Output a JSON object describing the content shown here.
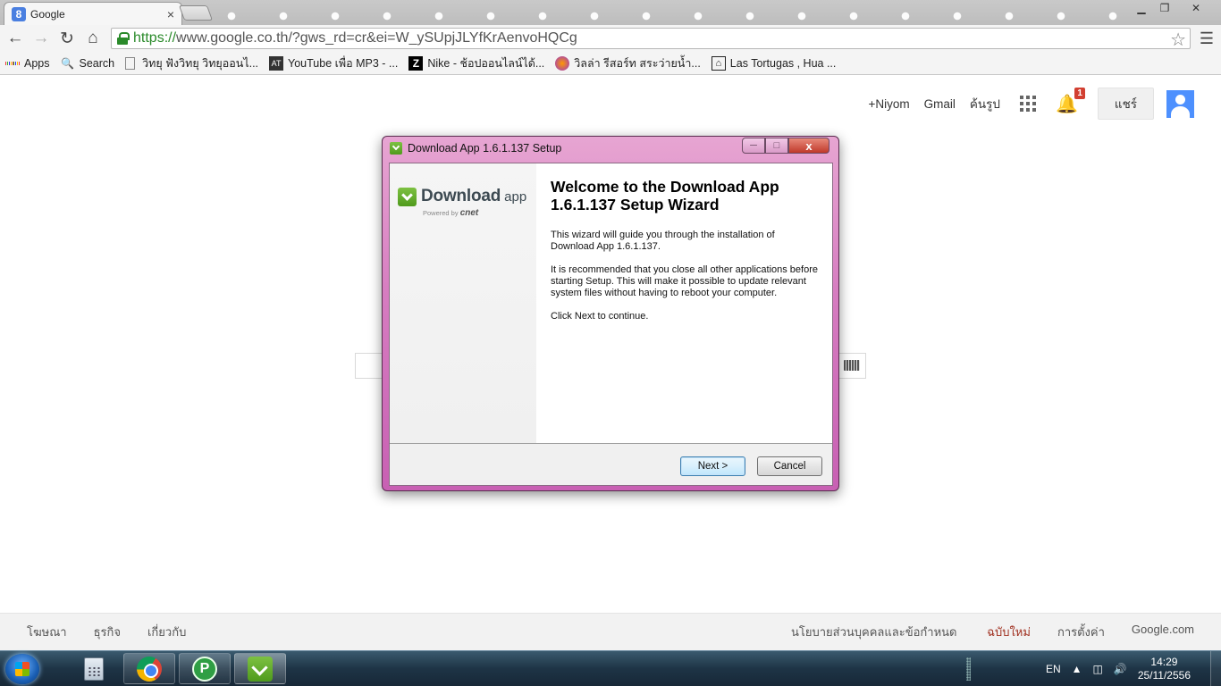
{
  "browser": {
    "tab_title": "Google",
    "tab_close": "×",
    "url_scheme": "https://",
    "url_rest": "www.google.co.th/?gws_rd=cr&ei=W_ySUpjJLYfKrAenvoHQCg",
    "win_min": "▁",
    "win_max": "❐",
    "win_close": "✕"
  },
  "bookmarks": [
    {
      "label": "Apps"
    },
    {
      "label": "Search"
    },
    {
      "label": "วิทยุ ฟังวิทยุ วิทยุออนไ..."
    },
    {
      "label": "YouTube เพื่อ MP3 - ..."
    },
    {
      "label": "Nike - ช้อปออนไลน์ได้..."
    },
    {
      "label": "วิลล่า รีสอร์ท สระว่ายน้ำ..."
    },
    {
      "label": "Las Tortugas , Hua ..."
    }
  ],
  "google": {
    "plus_name": "+Niyom",
    "gmail": "Gmail",
    "images": "ค้นรูป",
    "notifications": "1",
    "share": "แชร์",
    "footer_left": [
      "โฆษณา",
      "ธุรกิจ",
      "เกี่ยวกับ"
    ],
    "footer_privacy": "นโยบายส่วนบุคคลและข้อกำหนด",
    "footer_new": "ฉบับใหม่",
    "footer_settings": "การตั้งค่า",
    "footer_domain": "Google.com"
  },
  "dialog": {
    "title": "Download App 1.6.1.137 Setup",
    "logo_word": "Download",
    "logo_app": "app",
    "powered_by": "Powered by",
    "powered_brand": "cnet",
    "heading": "Welcome to the Download App 1.6.1.137 Setup Wizard",
    "para1": "This wizard will guide you through the installation of Download App 1.6.1.137.",
    "para2": "It is recommended that you close all other applications before starting Setup. This will make it possible to update relevant system files without having to reboot your computer.",
    "para3": "Click Next to continue.",
    "next_label": "Next >",
    "cancel_label": "Cancel",
    "close_glyph": "x"
  },
  "taskbar": {
    "lang": "EN",
    "time": "14:29",
    "date": "25/11/2556"
  },
  "colors": {
    "dialog_frame": "#d67cc0",
    "url_green": "#2a8a2a",
    "google_blue": "#4d90fe",
    "badge_red": "#d23f31"
  }
}
